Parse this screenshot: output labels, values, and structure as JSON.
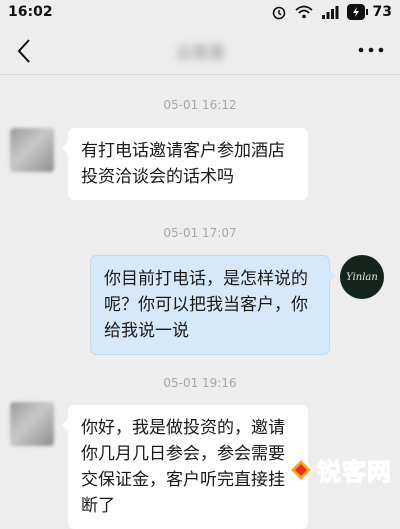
{
  "status_bar": {
    "time": "16:02",
    "battery": "73"
  },
  "nav": {
    "title": "云南酒"
  },
  "messages": [
    {
      "time": "05-01 16:12",
      "from": "contact",
      "text": "有打电话邀请客户参加酒店投资洽谈会的话术吗"
    },
    {
      "time": "05-01 17:07",
      "from": "me",
      "text": "你目前打电话，是怎样说的呢？你可以把我当客户，你给我说一说",
      "avatar_label": "Yinlan"
    },
    {
      "time": "05-01 19:16",
      "from": "contact",
      "text": "你好，我是做投资的，邀请你几月几日参会，参会需要交保证金，客户听完直接挂断了"
    }
  ],
  "watermark": {
    "text": "锐客网"
  }
}
